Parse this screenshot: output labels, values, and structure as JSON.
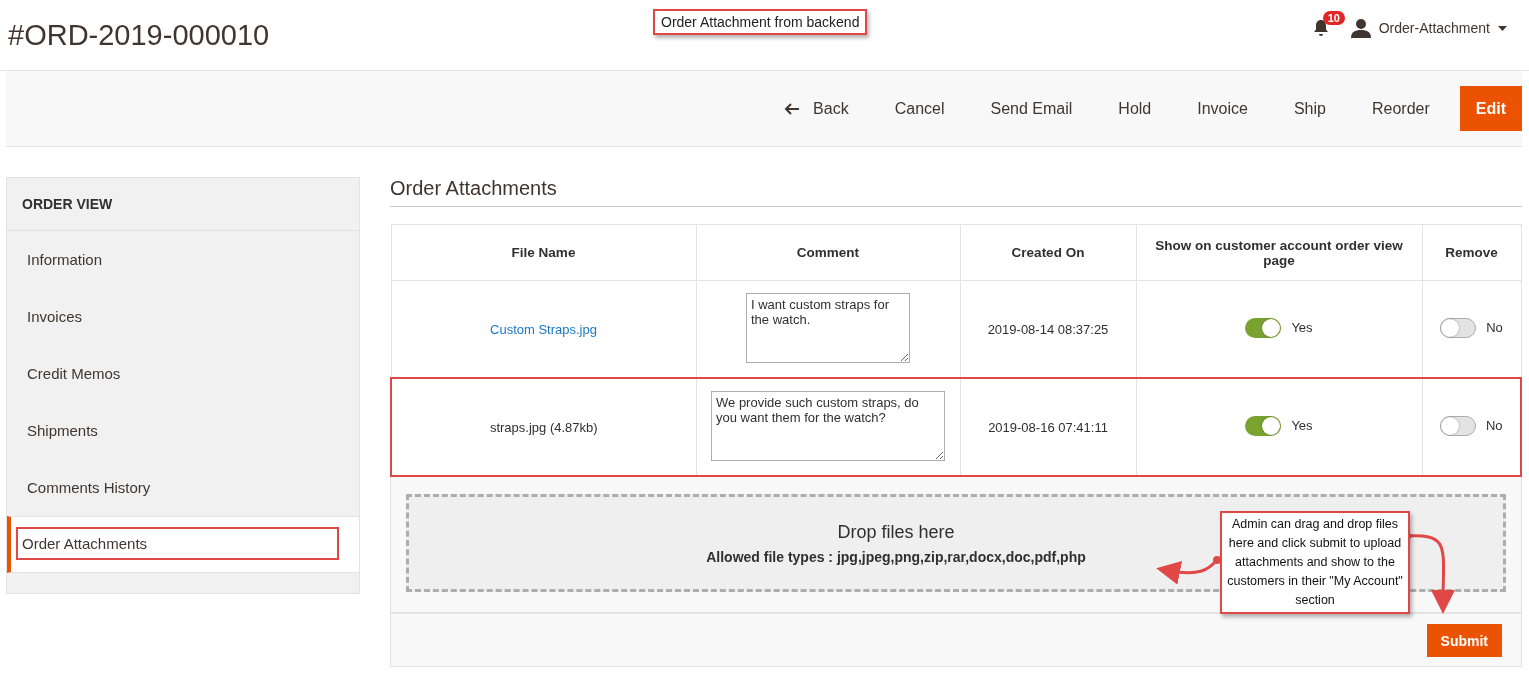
{
  "page_title": "#ORD-2019-000010",
  "top_note": "Order Attachment from backend",
  "header": {
    "notification_count": "10",
    "user": "Order-Attachment"
  },
  "actions": [
    {
      "label": "Back",
      "kind": "back"
    },
    {
      "label": "Cancel",
      "kind": "plain"
    },
    {
      "label": "Send Email",
      "kind": "plain"
    },
    {
      "label": "Hold",
      "kind": "plain"
    },
    {
      "label": "Invoice",
      "kind": "plain"
    },
    {
      "label": "Ship",
      "kind": "plain"
    },
    {
      "label": "Reorder",
      "kind": "plain"
    },
    {
      "label": "Edit",
      "kind": "primary"
    }
  ],
  "sidebar": {
    "title": "ORDER VIEW",
    "items": [
      {
        "label": "Information",
        "selected": false
      },
      {
        "label": "Invoices",
        "selected": false
      },
      {
        "label": "Credit Memos",
        "selected": false
      },
      {
        "label": "Shipments",
        "selected": false
      },
      {
        "label": "Comments History",
        "selected": false
      },
      {
        "label": "Order Attachments",
        "selected": true
      }
    ]
  },
  "section_title": "Order Attachments",
  "table": {
    "columns": [
      "File Name",
      "Comment",
      "Created On",
      "Show on customer account order view page",
      "Remove"
    ],
    "rows": [
      {
        "file_name": "Custom Straps.jpg",
        "kind": "link",
        "comment": "I want custom straps for the watch.",
        "created_on": "2019-08-14 08:37:25",
        "show": {
          "on": true,
          "label": "Yes"
        },
        "remove": {
          "on": false,
          "label": "No"
        },
        "highlighted": false
      },
      {
        "file_name": "straps.jpg (4.87kb)",
        "kind": "plain",
        "comment": "We provide such custom straps, do you want them for the watch?",
        "created_on": "2019-08-16 07:41:11",
        "show": {
          "on": true,
          "label": "Yes"
        },
        "remove": {
          "on": false,
          "label": "No"
        },
        "highlighted": true
      }
    ]
  },
  "dropzone": {
    "title": "Drop files here",
    "allowed": "Allowed file types : jpg,jpeg,png,zip,rar,docx,doc,pdf,php"
  },
  "callout": "Admin can drag and drop files here and click submit to upload attachments and show to the customers in their \"My Account\" section",
  "submit": "Submit"
}
